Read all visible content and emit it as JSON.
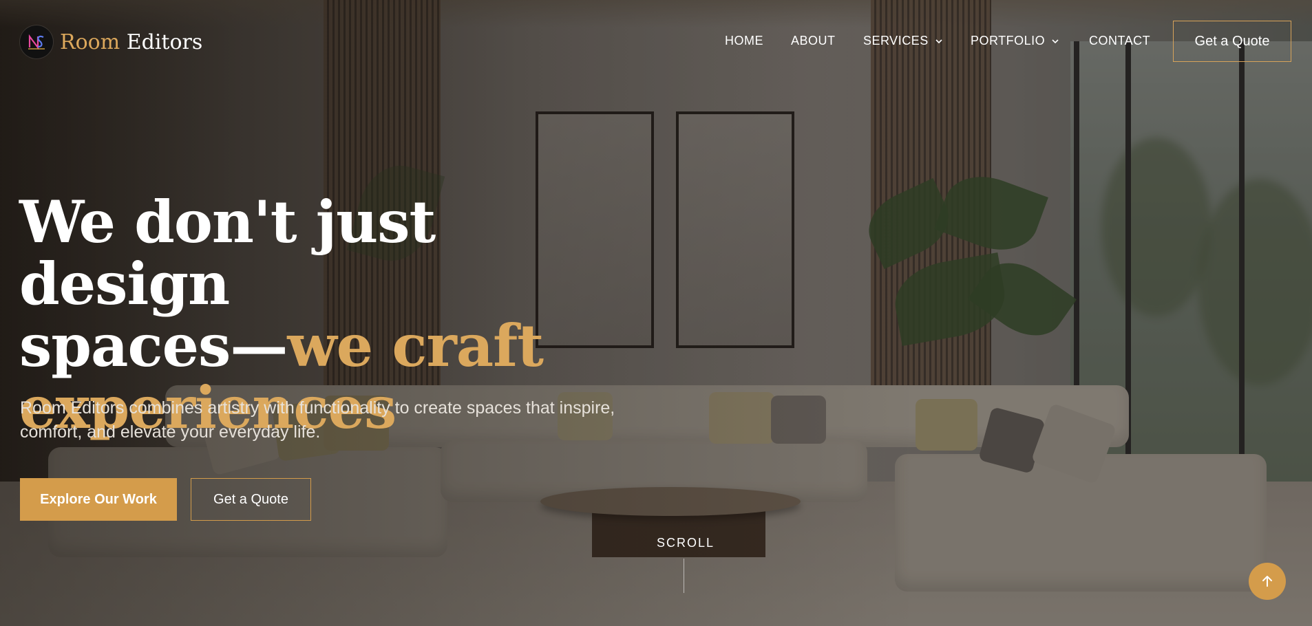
{
  "brand": {
    "name_accent": "Room",
    "name_rest": "Editors",
    "logo_icon": "ns-monogram-logo"
  },
  "nav": {
    "items": [
      {
        "label": "HOME",
        "has_dropdown": false
      },
      {
        "label": "ABOUT",
        "has_dropdown": false
      },
      {
        "label": "SERVICES",
        "has_dropdown": true
      },
      {
        "label": "PORTFOLIO",
        "has_dropdown": true
      },
      {
        "label": "CONTACT",
        "has_dropdown": false
      }
    ],
    "cta_label": "Get a Quote"
  },
  "hero": {
    "title_line1": "We don't just design",
    "title_line2_white": "spaces—",
    "title_line2_gold": "we craft",
    "title_line3_gold": "experiences",
    "subtitle": "Room Editors combines artistry with functionality to create spaces that inspire, comfort, and elevate your everyday life.",
    "primary_button": "Explore Our Work",
    "secondary_button": "Get a Quote",
    "scroll_label": "SCROLL"
  },
  "icons": {
    "dropdown": "chevron-down-icon",
    "back_to_top": "arrow-up-icon"
  },
  "colors": {
    "accent_gold": "#d49c4b",
    "heading_gold": "#dba85d",
    "text_white": "#ffffff"
  }
}
